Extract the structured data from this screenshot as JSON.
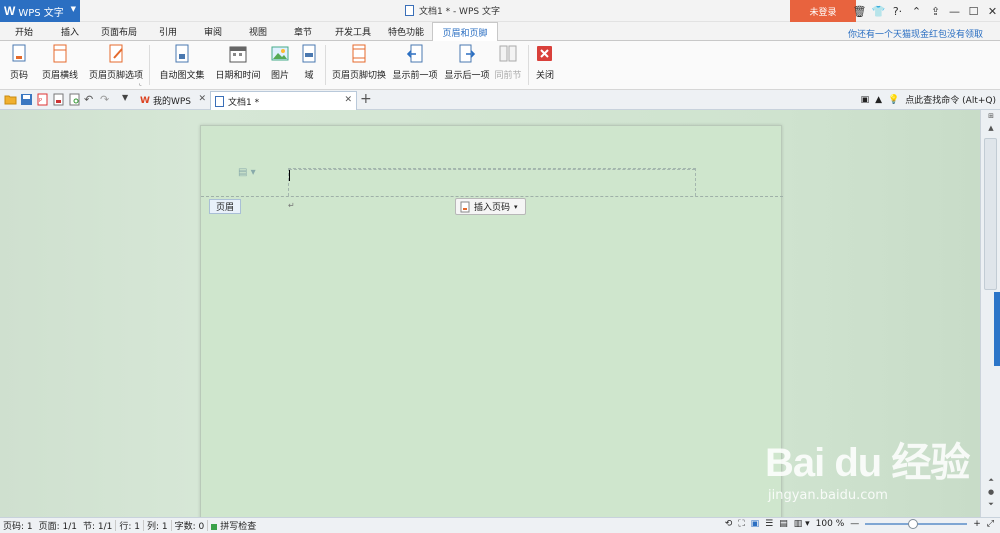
{
  "app": {
    "logo": "W",
    "name": "WPS 文字",
    "window_title": "文档1 * - WPS 文字",
    "login": "未登录"
  },
  "ribbon_tabs": [
    {
      "label": "开始"
    },
    {
      "label": "插入"
    },
    {
      "label": "页面布局"
    },
    {
      "label": "引用"
    },
    {
      "label": "审阅"
    },
    {
      "label": "视图"
    },
    {
      "label": "章节"
    },
    {
      "label": "开发工具"
    },
    {
      "label": "特色功能"
    },
    {
      "label": "页眉和页脚",
      "active": true
    }
  ],
  "promo_text": "你还有一个天猫现金红包没有领取",
  "ribbon_buttons": {
    "page_number": "页码",
    "header_line": "页眉横线",
    "header_footer_options": "页眉页脚选项",
    "auto_text": "自动图文集",
    "date_time": "日期和时间",
    "picture": "图片",
    "field": "域",
    "switch_header_footer": "页眉页脚切换",
    "show_previous": "显示前一项",
    "show_next": "显示后一项",
    "same_as_previous": "同前节",
    "close": "关闭"
  },
  "doc_tabs": [
    {
      "label": "我的WPS"
    },
    {
      "label": "文档1 *",
      "active": true
    }
  ],
  "find_command": "点此查找命令 (Alt+Q)",
  "document": {
    "header_label": "页眉",
    "insert_page_number": "插入页码"
  },
  "status": {
    "page_num": "页码: 1",
    "pages": "页面: 1/1",
    "section": "节: 1/1",
    "row": "行: 1",
    "col": "列: 1",
    "word_count": "字数: 0",
    "spell_check": "拼写检查",
    "zoom": "100 %",
    "zoom_fraction": 0.47
  },
  "watermark": {
    "brand": "Bai du 经验",
    "url": "jingyan.baidu.com"
  },
  "colors": {
    "accent": "#2b6fc2",
    "login_bg": "#e8633e",
    "page_bg": "#cfe6cd"
  }
}
